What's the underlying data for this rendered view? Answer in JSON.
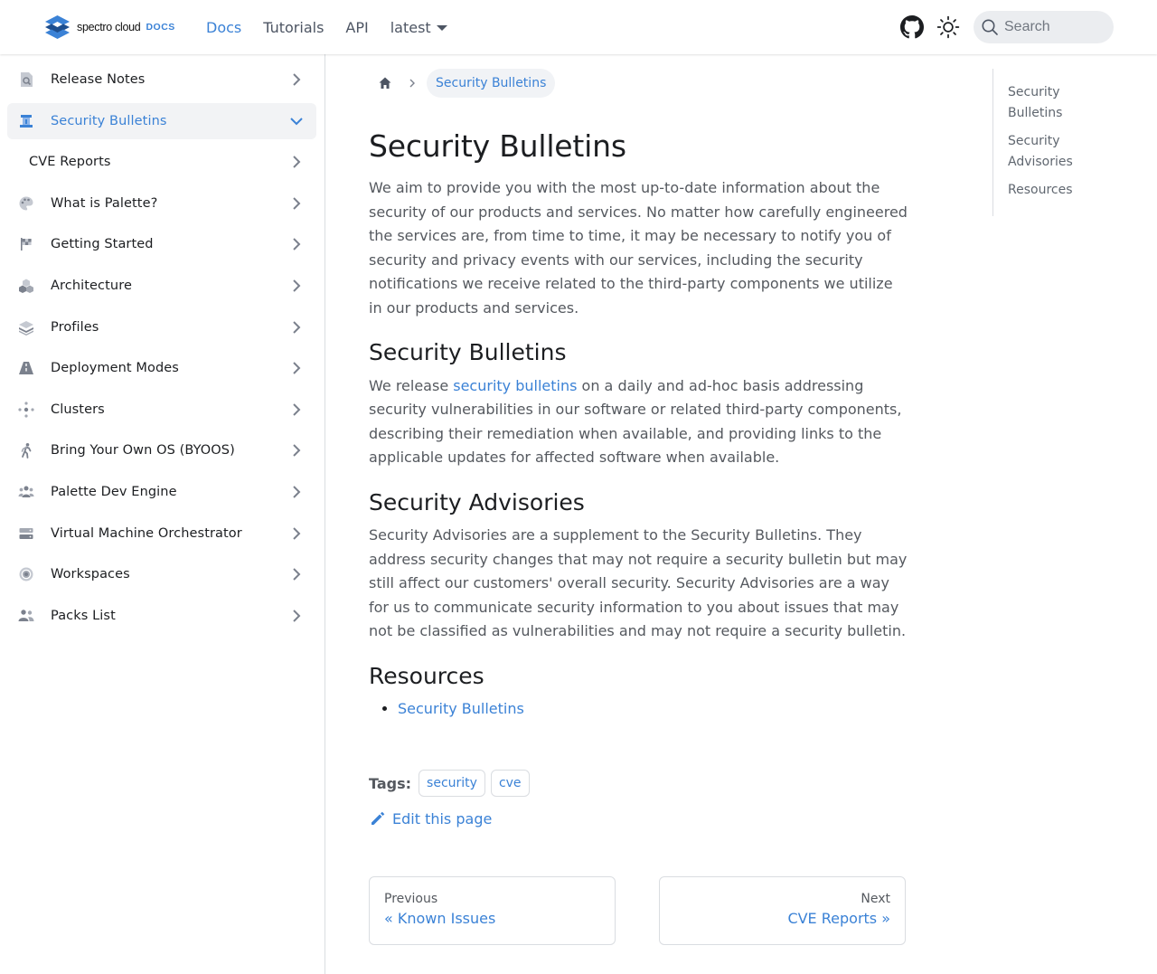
{
  "navbar": {
    "brand_name": "spectro cloud",
    "brand_docs": "DOCS",
    "links": [
      "Docs",
      "Tutorials",
      "API"
    ],
    "version": "latest",
    "search_placeholder": "Search",
    "accent_color": "#3b82d6"
  },
  "sidebar": {
    "items": [
      {
        "label": "Release Notes",
        "icon": "release-notes-icon"
      },
      {
        "label": "Security Bulletins",
        "icon": "security-bulletins-icon"
      },
      {
        "label": "CVE Reports",
        "icon": ""
      },
      {
        "label": "What is Palette?",
        "icon": "palette-icon"
      },
      {
        "label": "Getting Started",
        "icon": "flag-icon"
      },
      {
        "label": "Architecture",
        "icon": "architecture-icon"
      },
      {
        "label": "Profiles",
        "icon": "layers-icon"
      },
      {
        "label": "Deployment Modes",
        "icon": "road-icon"
      },
      {
        "label": "Clusters",
        "icon": "clusters-icon"
      },
      {
        "label": "Bring Your Own OS (BYOOS)",
        "icon": "person-icon"
      },
      {
        "label": "Palette Dev Engine",
        "icon": "users-icon"
      },
      {
        "label": "Virtual Machine Orchestrator",
        "icon": "server-icon"
      },
      {
        "label": "Workspaces",
        "icon": "target-icon"
      },
      {
        "label": "Packs List",
        "icon": "users-icon"
      }
    ]
  },
  "breadcrumb": {
    "current": "Security Bulletins"
  },
  "article": {
    "title": "Security Bulletins",
    "intro": "We aim to provide you with the most up-to-date information about the security of our products and services. No matter how carefully engineered the services are, from time to time, it may be necessary to notify you of security and privacy events with our services, including the security notifications we receive related to the third-party components we utilize in our products and services.",
    "s1_title": "Security Bulletins",
    "s1_pre": "We release ",
    "s1_link": "security bulletins",
    "s1_post": " on a daily and ad-hoc basis addressing security vulnerabilities in our software or related third-party components, describing their remediation when available, and providing links to the applicable updates for affected software when available.",
    "s2_title": "Security Advisories",
    "s2_body": "Security Advisories are a supplement to the Security Bulletins. They address security changes that may not require a security bulletin but may still affect our customers' overall security. Security Advisories are a way for us to communicate security information to you about issues that may not be classified as vulnerabilities and may not require a security bulletin.",
    "s3_title": "Resources",
    "resources": [
      "Security Bulletins"
    ]
  },
  "tags": {
    "label": "Tags:",
    "items": [
      "security",
      "cve"
    ]
  },
  "edit_link": "Edit this page",
  "pager": {
    "prev_sub": "Previous",
    "prev_label": "« Known Issues",
    "next_sub": "Next",
    "next_label": "CVE Reports »"
  },
  "toc": {
    "items": [
      "Security Bulletins",
      "Security Advisories",
      "Resources"
    ]
  }
}
